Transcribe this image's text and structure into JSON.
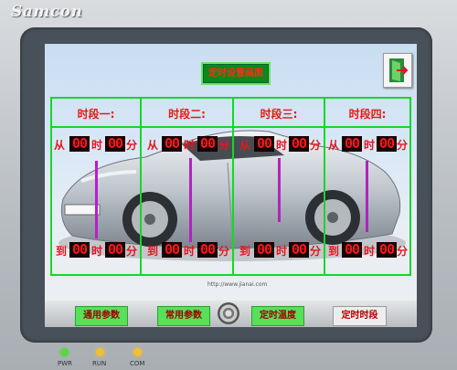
{
  "brand": "Samcon",
  "screen": {
    "title_button": "定时设置画面",
    "segments": [
      {
        "head": "时段一:",
        "from": "从",
        "to": "到",
        "hour": "时",
        "minute": "分",
        "from_h": "00",
        "from_m": "00",
        "to_h": "00",
        "to_m": "00"
      },
      {
        "head": "时段二:",
        "from": "从",
        "to": "到",
        "hour": "时",
        "minute": "分",
        "from_h": "00",
        "from_m": "00",
        "to_h": "00",
        "to_m": "00"
      },
      {
        "head": "时段三:",
        "from": "从",
        "to": "到",
        "hour": "时",
        "minute": "分",
        "from_h": "00",
        "from_m": "00",
        "to_h": "00",
        "to_m": "00"
      },
      {
        "head": "时段四:",
        "from": "从",
        "to": "到",
        "hour": "时",
        "minute": "分",
        "from_h": "00",
        "from_m": "00",
        "to_h": "00",
        "to_m": "00"
      }
    ],
    "tabs": [
      {
        "label": "通用参数",
        "active": false
      },
      {
        "label": "常用参数",
        "active": false
      },
      {
        "label": "定时温度",
        "active": false
      },
      {
        "label": "定时时段",
        "active": true
      }
    ],
    "url_text": "http://www.jianai.com"
  },
  "leds": [
    {
      "label": "PWR",
      "color": "#58d642"
    },
    {
      "label": "RUN",
      "color": "#f0c030"
    },
    {
      "label": "COM",
      "color": "#f0c030"
    }
  ],
  "colors": {
    "grid": "#17d52c",
    "digit_bg": "#160000",
    "digit_fg": "#ff1717",
    "label_red": "#e8151c"
  }
}
